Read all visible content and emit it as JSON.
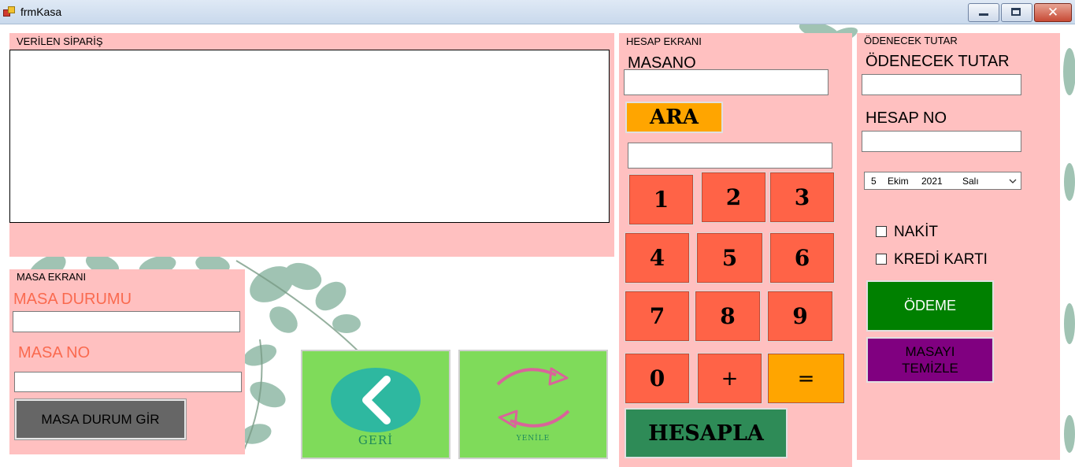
{
  "window": {
    "title": "frmKasa"
  },
  "order_panel": {
    "caption": "VERİLEN SİPARİŞ"
  },
  "table_panel": {
    "caption": "MASA EKRANI",
    "status_label": "MASA DURUMU",
    "status_value": "",
    "no_label": "MASA NO",
    "no_value": "",
    "enter_status_button": "MASA DURUM GİR"
  },
  "nav": {
    "back_label": "GERİ",
    "refresh_label": "YENİLE"
  },
  "bill_panel": {
    "caption": "HESAP EKRANI",
    "table_no_label": "MASANO",
    "table_no_value": "",
    "search_button": "ARA",
    "display_value": "",
    "keys": [
      "1",
      "2",
      "3",
      "4",
      "5",
      "6",
      "7",
      "8",
      "9",
      "0",
      "+",
      "="
    ],
    "calculate_button": "HESAPLA"
  },
  "payment_panel": {
    "caption": "ÖDENECEK TUTAR",
    "amount_label": "ÖDENECEK TUTAR",
    "amount_value": "",
    "bill_no_label": "HESAP NO",
    "bill_no_value": "",
    "date": {
      "day": "5",
      "month": "Ekim",
      "year": "2021",
      "weekday": "Salı"
    },
    "cash_label": "NAKİT",
    "cash_checked": false,
    "card_label": "KREDİ KARTI",
    "card_checked": false,
    "pay_button": "ÖDEME",
    "clear_table_button_line1": "MASAYI",
    "clear_table_button_line2": "TEMİZLE"
  },
  "colors": {
    "panel": "#ffc0c0",
    "key": "#ff6347",
    "accent_orange": "#ffa500",
    "calculate_green": "#2e8b57",
    "pay_green": "#008000",
    "clear_purple": "#800080",
    "nav_green": "#7fdb5a",
    "label_red": "#fa6a4f"
  }
}
